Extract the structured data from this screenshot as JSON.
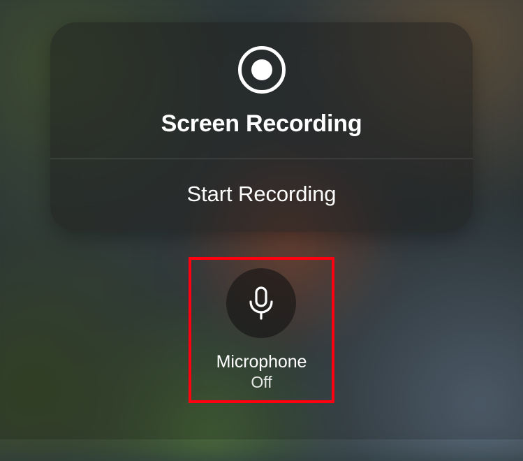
{
  "panel": {
    "title": "Screen Recording",
    "action_label": "Start Recording"
  },
  "microphone": {
    "label": "Microphone",
    "status": "Off"
  }
}
